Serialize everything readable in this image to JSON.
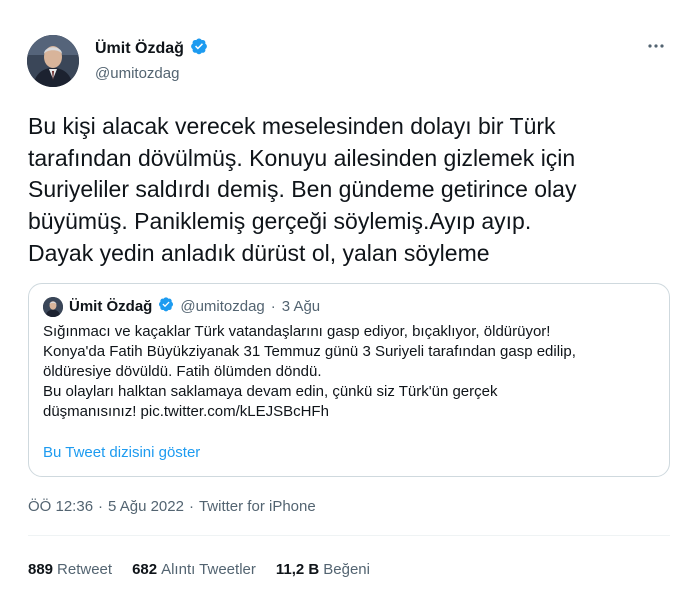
{
  "author": {
    "name": "Ümit Özdağ",
    "handle": "@umitozdag",
    "verified": true
  },
  "tweet": {
    "text": "Bu kişi alacak verecek meselesinden dolayı bir Türk\ntarafından dövülmüş. Konuyu ailesinden gizlemek için\nSuriyeliler saldırdı demiş. Ben gündeme getirince olay\nbüyümüş. Paniklemiş gerçeği söylemiş.Ayıp ayıp.\nDayak yedin anladık dürüst ol, yalan söyleme"
  },
  "quoted": {
    "name": "Ümit Özdağ",
    "handle": "@umitozdag",
    "separator": "·",
    "date": "3 Ağu",
    "text": "Sığınmacı ve kaçaklar Türk vatandaşlarını gasp ediyor, bıçaklıyor, öldürüyor!\nKonya'da Fatih Büyükziyanak 31 Temmuz günü 3 Suriyeli tarafından gasp edilip,\nöldüresiye dövüldü. Fatih ölümden döndü.\nBu olayları halktan saklamaya devam edin, çünkü siz Türk'ün gerçek\ndüşmanısınız! pic.twitter.com/kLEJSBcHFh",
    "show_thread": "Bu Tweet dizisini göster"
  },
  "meta": {
    "time": "ÖÖ 12:36",
    "sep1": "·",
    "date": "5 Ağu 2022",
    "sep2": "·",
    "source": "Twitter for iPhone"
  },
  "stats": {
    "retweets_count": "889",
    "retweets_label": "Retweet",
    "quotes_count": "682",
    "quotes_label": "Alıntı Tweetler",
    "likes_count": "11,2 B",
    "likes_label": "Beğeni"
  },
  "colors": {
    "verified_badge": "#1d9bf0",
    "link": "#1d9bf0",
    "secondary_text": "#536471"
  },
  "icons": {
    "verified": "verified-badge-icon",
    "more": "more-options-icon"
  }
}
